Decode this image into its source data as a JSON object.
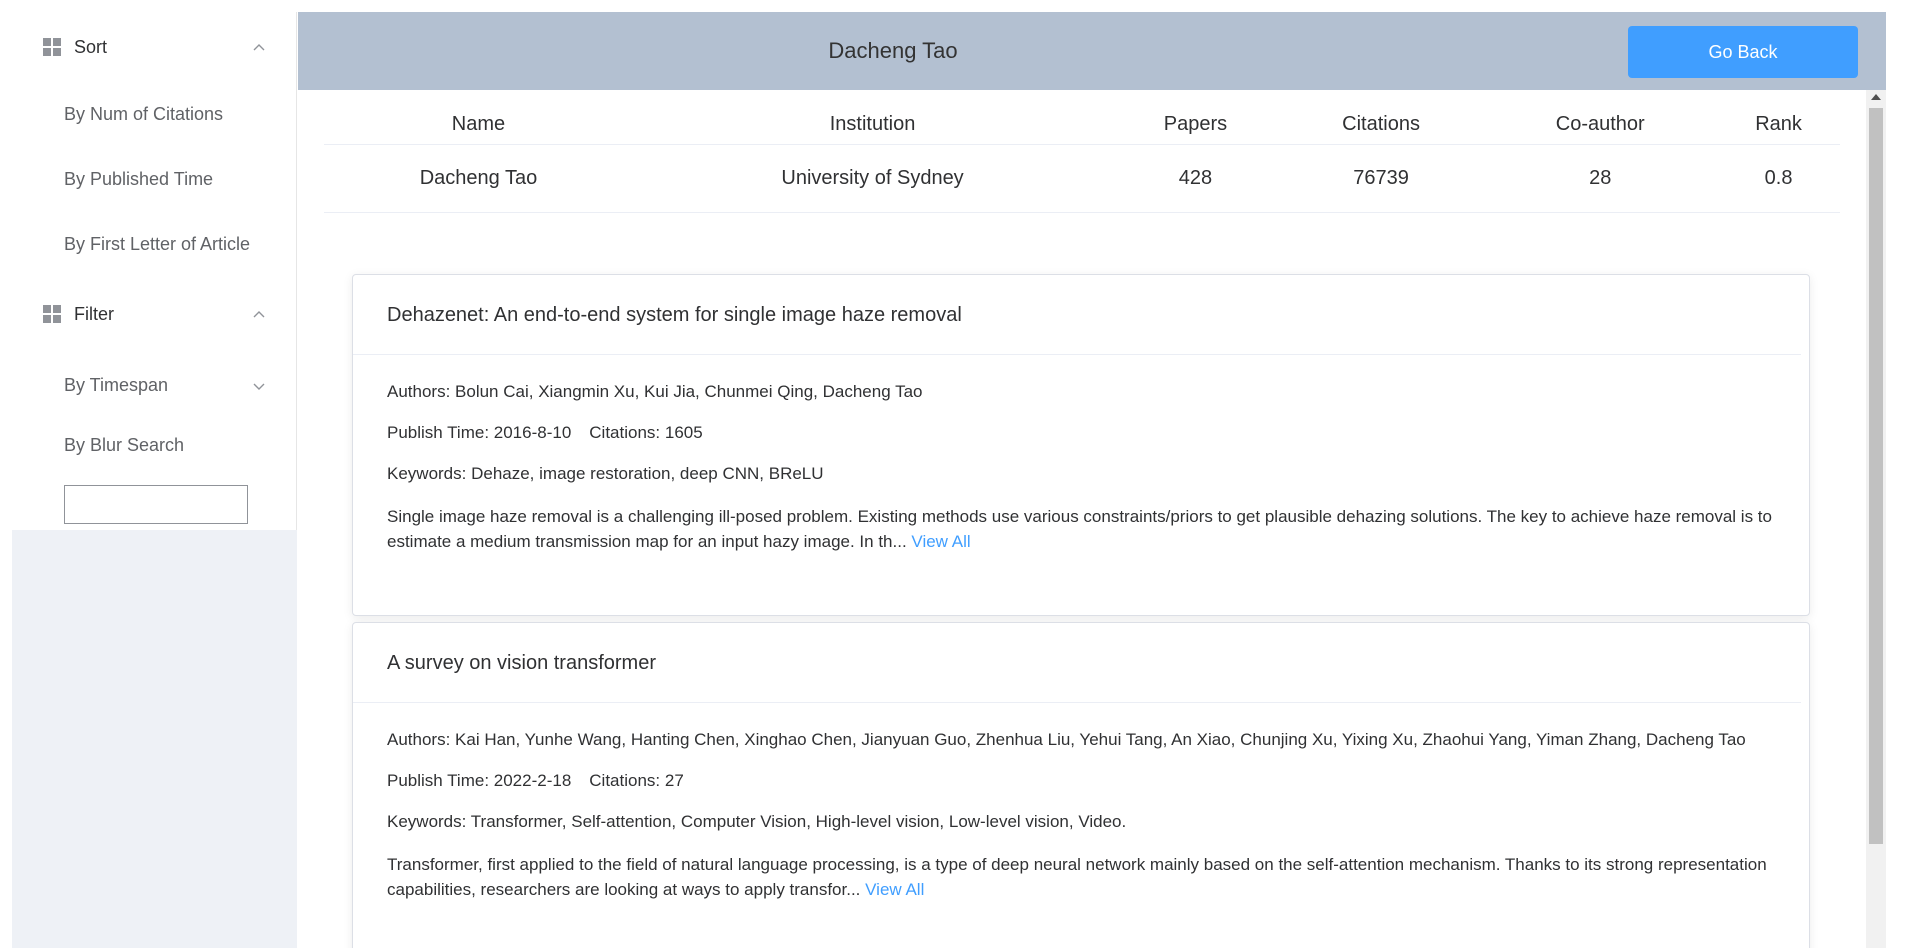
{
  "sidebar": {
    "sort": {
      "title": "Sort",
      "items": [
        "By Num of Citations",
        "By Published Time",
        "By First Letter of Article"
      ]
    },
    "filter": {
      "title": "Filter",
      "timespan": "By Timespan",
      "blur": "By Blur Search",
      "search_value": ""
    }
  },
  "header": {
    "title": "Dacheng Tao",
    "go_back": "Go Back"
  },
  "info": {
    "columns": [
      "Name",
      "Institution",
      "Papers",
      "Citations",
      "Co-author",
      "Rank"
    ],
    "row": [
      "Dacheng Tao",
      "University of Sydney",
      "428",
      "76739",
      "28",
      "0.8"
    ]
  },
  "papers": [
    {
      "title": "Dehazenet: An end-to-end system for single image haze removal",
      "authors": "Authors: Bolun Cai, Xiangmin Xu, Kui Jia, Chunmei Qing, Dacheng Tao",
      "publish": "Publish Time: 2016-8-10",
      "citations": "Citations: 1605",
      "keywords": "Keywords: Dehaze, image restoration, deep CNN, BReLU",
      "abstract": "Single image haze removal is a challenging ill-posed problem. Existing methods use various constraints/priors to get plausible dehazing solutions. The key to achieve haze removal is to estimate a medium transmission map for an input hazy image. In th...",
      "view_all": "View All"
    },
    {
      "title": "A survey on vision transformer",
      "authors": "Authors: Kai Han, Yunhe Wang, Hanting Chen, Xinghao Chen, Jianyuan Guo, Zhenhua Liu, Yehui Tang, An Xiao, Chunjing Xu, Yixing Xu, Zhaohui Yang, Yiman Zhang, Dacheng Tao",
      "publish": "Publish Time: 2022-2-18",
      "citations": "Citations: 27",
      "keywords": "Keywords: Transformer, Self-attention, Computer Vision, High-level vision, Low-level vision, Video.",
      "abstract": "Transformer, first applied to the field of natural language processing, is a type of deep neural network mainly based on the self-attention mechanism. Thanks to its strong representation capabilities, researchers are looking at ways to apply transfor...",
      "view_all": "View All"
    }
  ],
  "colors": {
    "header_bg": "#b3c0d1",
    "accent": "#409eff",
    "sidebar_bg": "#eef1f6"
  }
}
